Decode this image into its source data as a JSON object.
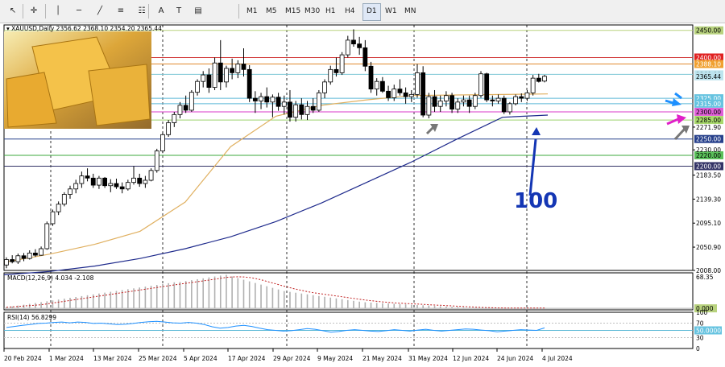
{
  "toolbar": {
    "tools": [
      {
        "name": "cursor-icon",
        "glyph": "↖"
      },
      {
        "name": "crosshair-icon",
        "glyph": "✛"
      },
      {
        "name": "vertical-line-icon",
        "glyph": "│"
      },
      {
        "name": "horizontal-line-icon",
        "glyph": "─"
      },
      {
        "name": "trendline-icon",
        "glyph": "╱"
      },
      {
        "name": "channel-icon",
        "glyph": "≡"
      },
      {
        "name": "fibonacci-icon",
        "glyph": "☷"
      },
      {
        "name": "text-icon",
        "glyph": "A"
      },
      {
        "name": "label-icon",
        "glyph": "T"
      },
      {
        "name": "shapes-icon",
        "glyph": "▤"
      }
    ],
    "timeframes": [
      "M1",
      "M5",
      "M15",
      "M30",
      "H1",
      "H4",
      "D1",
      "W1",
      "MN"
    ],
    "active_timeframe": "D1"
  },
  "chart_data": [
    {
      "type": "candlestick",
      "title": "XAUUSD,Daily",
      "ohlc_text": "2356.62 2368.10 2354.20 2365.44",
      "y_ticks": [
        "2450.00",
        "2400.00",
        "2388.10",
        "2369.00",
        "2365.44",
        "2325.00",
        "2315.00",
        "2300.00",
        "2285.00",
        "2271.90",
        "2250.00",
        "2230.00",
        "2220.00",
        "2200.00",
        "2183.50",
        "2139.30",
        "2095.10",
        "2050.90",
        "2008.00"
      ],
      "ylim": [
        2008,
        2460
      ],
      "x_labels": [
        "20 Feb 2024",
        "1 Mar 2024",
        "13 Mar 2024",
        "25 Mar 2024",
        "5 Apr 2024",
        "17 Apr 2024",
        "29 Apr 2024",
        "9 May 2024",
        "21 May 2024",
        "31 May 2024",
        "12 Jun 2024",
        "24 Jun 2024",
        "4 Jul 2024"
      ],
      "horizontal_levels": [
        {
          "value": 2450,
          "color": "#b8d27e"
        },
        {
          "value": 2400,
          "color": "#d23c3c"
        },
        {
          "value": 2388.1,
          "color": "#e08a2e"
        },
        {
          "value": 2369,
          "color": "#7cc7d6"
        },
        {
          "value": 2325,
          "color": "#5bb8d6"
        },
        {
          "value": 2315,
          "color": "#5bb8d6"
        },
        {
          "value": 2300,
          "color": "#d838c8"
        },
        {
          "value": 2285,
          "color": "#9ad26c"
        },
        {
          "value": 2250,
          "color": "#27408b"
        },
        {
          "value": 2220,
          "color": "#3ca83c"
        },
        {
          "value": 2200,
          "color": "#333366"
        }
      ],
      "price_tags": [
        {
          "value": 2450,
          "text": "2450.00",
          "bg": "#b8d27e",
          "fg": "#000"
        },
        {
          "value": 2400,
          "text": "2400.00",
          "bg": "#e02020",
          "fg": "#fff"
        },
        {
          "value": 2388.1,
          "text": "2388.10",
          "bg": "#f0a030",
          "fg": "#fff"
        },
        {
          "value": 2369,
          "text": "2369.00",
          "bg": "#bde4ee",
          "fg": "#000"
        },
        {
          "value": 2365.44,
          "text": "2365.44",
          "bg": "#bde4ee",
          "fg": "#000"
        },
        {
          "value": 2325,
          "text": "2325.00",
          "bg": "#66c3e0",
          "fg": "#fff"
        },
        {
          "value": 2315,
          "text": "2315.00",
          "bg": "#66c3e0",
          "fg": "#fff"
        },
        {
          "value": 2300,
          "text": "2300.00",
          "bg": "#e060d8",
          "fg": "#000"
        },
        {
          "value": 2285,
          "text": "2285.00",
          "bg": "#a8d86c",
          "fg": "#000"
        },
        {
          "value": 2250,
          "text": "2250.00",
          "bg": "#27408b",
          "fg": "#fff"
        },
        {
          "value": 2220,
          "text": "2220.00",
          "bg": "#5abf5a",
          "fg": "#000"
        },
        {
          "value": 2200,
          "text": "2200.00",
          "bg": "#333366",
          "fg": "#fff"
        }
      ],
      "candles": [
        [
          2018,
          2032,
          2012,
          2028
        ],
        [
          2028,
          2036,
          2021,
          2024
        ],
        [
          2024,
          2039,
          2020,
          2035
        ],
        [
          2035,
          2040,
          2025,
          2030
        ],
        [
          2030,
          2045,
          2028,
          2040
        ],
        [
          2040,
          2047,
          2033,
          2036
        ],
        [
          2036,
          2052,
          2035,
          2048
        ],
        [
          2048,
          2098,
          2046,
          2094
        ],
        [
          2094,
          2120,
          2090,
          2116
        ],
        [
          2116,
          2135,
          2110,
          2130
        ],
        [
          2130,
          2152,
          2126,
          2148
        ],
        [
          2148,
          2164,
          2140,
          2158
        ],
        [
          2158,
          2175,
          2150,
          2168
        ],
        [
          2168,
          2190,
          2160,
          2182
        ],
        [
          2182,
          2196,
          2172,
          2178
        ],
        [
          2178,
          2186,
          2160,
          2165
        ],
        [
          2165,
          2182,
          2158,
          2178
        ],
        [
          2178,
          2180,
          2160,
          2164
        ],
        [
          2164,
          2176,
          2152,
          2168
        ],
        [
          2168,
          2177,
          2158,
          2162
        ],
        [
          2162,
          2170,
          2150,
          2158
        ],
        [
          2158,
          2175,
          2155,
          2170
        ],
        [
          2170,
          2200,
          2166,
          2178
        ],
        [
          2178,
          2186,
          2162,
          2168
        ],
        [
          2168,
          2182,
          2160,
          2174
        ],
        [
          2174,
          2196,
          2172,
          2192
        ],
        [
          2192,
          2232,
          2188,
          2228
        ],
        [
          2228,
          2262,
          2224,
          2258
        ],
        [
          2258,
          2285,
          2254,
          2280
        ],
        [
          2280,
          2300,
          2272,
          2295
        ],
        [
          2295,
          2318,
          2288,
          2312
        ],
        [
          2312,
          2330,
          2298,
          2303
        ],
        [
          2303,
          2340,
          2300,
          2336
        ],
        [
          2336,
          2360,
          2330,
          2356
        ],
        [
          2356,
          2375,
          2345,
          2368
        ],
        [
          2368,
          2380,
          2335,
          2345
        ],
        [
          2345,
          2400,
          2340,
          2390
        ],
        [
          2390,
          2432,
          2340,
          2355
        ],
        [
          2355,
          2385,
          2345,
          2380
        ],
        [
          2380,
          2398,
          2360,
          2372
        ],
        [
          2372,
          2395,
          2362,
          2388
        ],
        [
          2388,
          2417,
          2365,
          2378
        ],
        [
          2378,
          2386,
          2318,
          2325
        ],
        [
          2325,
          2338,
          2298,
          2320
        ],
        [
          2320,
          2335,
          2305,
          2328
        ],
        [
          2328,
          2345,
          2308,
          2318
        ],
        [
          2318,
          2332,
          2290,
          2327
        ],
        [
          2327,
          2335,
          2302,
          2310
        ],
        [
          2310,
          2330,
          2295,
          2318
        ],
        [
          2318,
          2340,
          2282,
          2290
        ],
        [
          2290,
          2320,
          2282,
          2313
        ],
        [
          2313,
          2325,
          2286,
          2295
        ],
        [
          2295,
          2320,
          2285,
          2310
        ],
        [
          2310,
          2325,
          2298,
          2303
        ],
        [
          2303,
          2340,
          2300,
          2335
        ],
        [
          2335,
          2360,
          2325,
          2355
        ],
        [
          2355,
          2385,
          2350,
          2378
        ],
        [
          2378,
          2400,
          2365,
          2372
        ],
        [
          2372,
          2410,
          2368,
          2405
        ],
        [
          2405,
          2440,
          2400,
          2432
        ],
        [
          2432,
          2452,
          2420,
          2425
        ],
        [
          2425,
          2438,
          2405,
          2418
        ],
        [
          2418,
          2432,
          2375,
          2384
        ],
        [
          2384,
          2392,
          2335,
          2342
        ],
        [
          2342,
          2362,
          2330,
          2356
        ],
        [
          2356,
          2364,
          2335,
          2338
        ],
        [
          2338,
          2348,
          2320,
          2326
        ],
        [
          2326,
          2350,
          2320,
          2342
        ],
        [
          2342,
          2360,
          2330,
          2335
        ],
        [
          2335,
          2345,
          2315,
          2328
        ],
        [
          2328,
          2340,
          2318,
          2332
        ],
        [
          2332,
          2388,
          2326,
          2372
        ],
        [
          2372,
          2384,
          2290,
          2294
        ],
        [
          2294,
          2335,
          2288,
          2328
        ],
        [
          2328,
          2340,
          2300,
          2310
        ],
        [
          2310,
          2330,
          2300,
          2320
        ],
        [
          2320,
          2338,
          2310,
          2330
        ],
        [
          2330,
          2335,
          2298,
          2305
        ],
        [
          2305,
          2325,
          2298,
          2318
        ],
        [
          2318,
          2330,
          2310,
          2322
        ],
        [
          2322,
          2330,
          2298,
          2310
        ],
        [
          2310,
          2335,
          2305,
          2330
        ],
        [
          2330,
          2375,
          2326,
          2370
        ],
        [
          2370,
          2372,
          2318,
          2322
        ],
        [
          2322,
          2330,
          2310,
          2320
        ],
        [
          2320,
          2332,
          2315,
          2325
        ],
        [
          2325,
          2330,
          2296,
          2300
        ],
        [
          2300,
          2318,
          2295,
          2315
        ],
        [
          2315,
          2332,
          2312,
          2328
        ],
        [
          2328,
          2334,
          2318,
          2325
        ],
        [
          2325,
          2340,
          2320,
          2335
        ],
        [
          2335,
          2368,
          2330,
          2362
        ],
        [
          2362,
          2370,
          2354,
          2356
        ],
        [
          2356.62,
          2368.1,
          2354.2,
          2365.44
        ]
      ],
      "ma_slow": [
        2000,
        2006,
        2016,
        2030,
        2048,
        2070,
        2098,
        2132,
        2170,
        2208,
        2250,
        2290,
        2294
      ],
      "ma_fast": [
        2023,
        2038,
        2056,
        2080,
        2134,
        2236,
        2292,
        2312,
        2322,
        2330,
        2331,
        2332,
        2333
      ],
      "annotation_text": "100",
      "annotation_color": "#1436b4"
    },
    {
      "type": "histogram",
      "title": "MACD(12,26,9) 4.034 -2.108",
      "y_ticks": [
        "68.35",
        "0.000"
      ],
      "ylim": [
        -3,
        70
      ],
      "zero_line_color": "#aaaaaa",
      "signal_color": "#c02020"
    },
    {
      "type": "line",
      "title": "RSI(14) 56.8299",
      "y_ticks": [
        "100",
        "70",
        "50.0000",
        "30",
        "0"
      ],
      "ylim": [
        0,
        100
      ],
      "levels": [
        70,
        50,
        30
      ],
      "line_color": "#1e90ff",
      "values": [
        58,
        61,
        64,
        66,
        69,
        70,
        72,
        73,
        71,
        73,
        72,
        69,
        70,
        68,
        66,
        67,
        69,
        72,
        74,
        75,
        73,
        71,
        70,
        72,
        70,
        66,
        60,
        56,
        58,
        62,
        64,
        61,
        56,
        52,
        50,
        48,
        49,
        52,
        55,
        53,
        49,
        45,
        47,
        50,
        52,
        50,
        48,
        47,
        49,
        52,
        50,
        48,
        51,
        53,
        50,
        48,
        50,
        52,
        54,
        53,
        51,
        49,
        46,
        48,
        50,
        52,
        51,
        50,
        57
      ]
    }
  ]
}
